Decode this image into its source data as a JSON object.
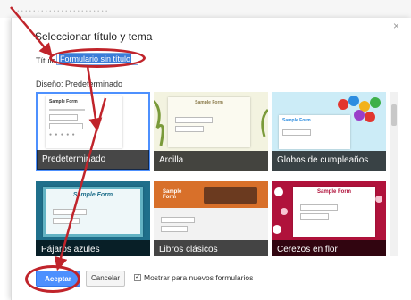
{
  "background_text": "........................",
  "dialog": {
    "close_glyph": "×",
    "heading": "Seleccionar título y tema",
    "title_label": "Título:",
    "title_value": "Formulario sin título",
    "design_label": "Diseño: Predeterminado"
  },
  "themes": [
    {
      "label": "Predeterminado",
      "sample": "Sample Form",
      "selected": true
    },
    {
      "label": "Arcilla",
      "sample": "Sample Form",
      "selected": false
    },
    {
      "label": "Globos de cumpleaños",
      "sample": "Sample Form",
      "selected": false
    },
    {
      "label": "Pájaros azules",
      "sample": "Sample Form",
      "selected": false
    },
    {
      "label": "Libros clásicos",
      "sample": "Sample Form",
      "selected": false
    },
    {
      "label": "Cerezos en flor",
      "sample": "Sample Form",
      "selected": false
    }
  ],
  "footer": {
    "accept": "Aceptar",
    "cancel": "Cancelar",
    "checkbox_label": "Mostrar para nuevos formularios",
    "checkbox_checked": true
  },
  "colors": {
    "accent_blue": "#4d90fe",
    "annotation_red": "#c0242b"
  }
}
